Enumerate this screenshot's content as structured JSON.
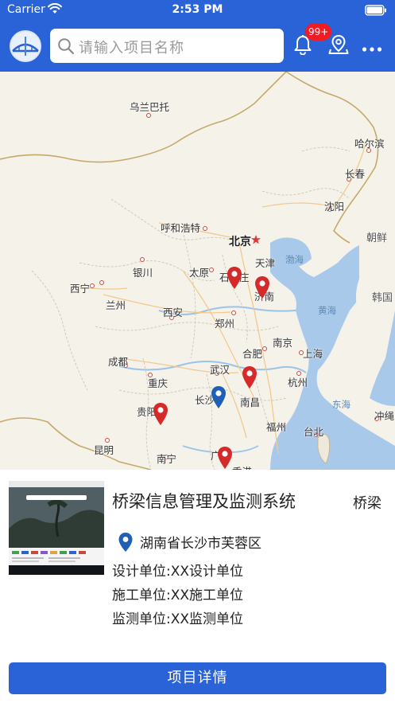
{
  "status_bar": {
    "carrier": "Carrier",
    "time": "2:53 PM"
  },
  "nav": {
    "search_placeholder": "请输入项目名称",
    "notification_badge": "99+"
  },
  "map": {
    "labels": {
      "ulaanbaatar": "乌兰巴托",
      "harbin": "哈尔滨",
      "changchun": "长春",
      "shenyang": "沈阳",
      "hohhot": "呼和浩特",
      "beijing": "北京",
      "dprk": "朝鲜",
      "tianjin": "天津",
      "bohai": "渤海",
      "yinchuan": "银川",
      "taiyuan": "太原",
      "shijiazhuang": "石家庄",
      "jinan": "济南",
      "rok": "韩国",
      "xining": "西宁",
      "lanzhou": "兰州",
      "yellow_sea": "黄海",
      "xian": "西安",
      "zhengzhou": "郑州",
      "chengdu": "成都",
      "nanjing": "南京",
      "hefei": "合肥",
      "shanghai": "上海",
      "wuhan": "武汉",
      "chongqing": "重庆",
      "hangzhou": "杭州",
      "changsha": "长沙",
      "nanchang": "南昌",
      "east_sea": "东海",
      "guiyang": "贵阳",
      "fuzhou": "福州",
      "okinawa": "冲绳",
      "kunming": "昆明",
      "taipei": "台北",
      "nanning": "南宁",
      "guangzhou": "广州",
      "hongkong": "香港"
    }
  },
  "card": {
    "title": "桥梁信息管理及监测系统",
    "tag": "桥梁",
    "address": "湖南省长沙市芙蓉区",
    "design_unit": "设计单位:XX设计单位",
    "construction_unit": "施工单位:XX施工单位",
    "monitoring_unit": "监测单位:XX监测单位",
    "detail_button": "项目详情"
  },
  "colors": {
    "primary": "#2a63d8",
    "badge": "#ee1c25",
    "pin_red": "#d42a2a",
    "pin_blue": "#1f5fb5",
    "water": "#a9c9ea",
    "land": "#f5f2ea"
  },
  "icons": [
    "wifi-icon",
    "battery-icon",
    "bridge-logo-icon",
    "search-icon",
    "bell-icon",
    "location-icon",
    "more-icon",
    "map-pin-icon"
  ]
}
